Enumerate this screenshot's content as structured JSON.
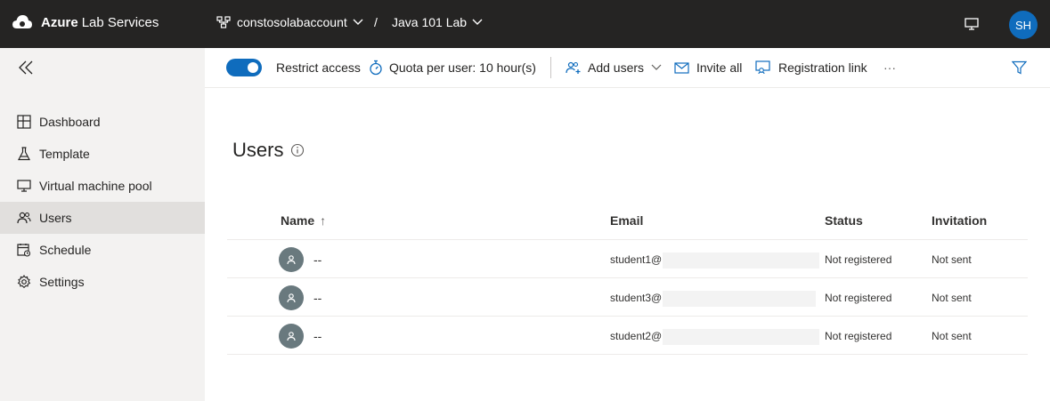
{
  "app": {
    "brand_bold": "Azure",
    "brand_rest": "Lab Services"
  },
  "breadcrumb": {
    "account": "constosolabaccount",
    "separator": "/",
    "lab": "Java 101 Lab"
  },
  "user": {
    "initials": "SH"
  },
  "sidebar": {
    "items": [
      {
        "label": "Dashboard",
        "icon": "dashboard-icon"
      },
      {
        "label": "Template",
        "icon": "flask-icon"
      },
      {
        "label": "Virtual machine pool",
        "icon": "monitor-icon"
      },
      {
        "label": "Users",
        "icon": "users-icon",
        "active": true
      },
      {
        "label": "Schedule",
        "icon": "calendar-icon"
      },
      {
        "label": "Settings",
        "icon": "gear-icon"
      }
    ]
  },
  "commandbar": {
    "restrict_access": "Restrict access",
    "restrict_access_on": true,
    "quota": "Quota per user: 10 hour(s)",
    "add_users": "Add users",
    "invite_all": "Invite all",
    "registration_link": "Registration link",
    "more": "···"
  },
  "page": {
    "title": "Users"
  },
  "table": {
    "headers": {
      "name": "Name",
      "sort": "↑",
      "email": "Email",
      "status": "Status",
      "invitation": "Invitation"
    },
    "rows": [
      {
        "name": "--",
        "email": "student1@",
        "status": "Not registered",
        "invitation": "Not sent"
      },
      {
        "name": "--",
        "email": "student3@",
        "status": "Not registered",
        "invitation": "Not sent"
      },
      {
        "name": "--",
        "email": "student2@",
        "status": "Not registered",
        "invitation": "Not sent"
      }
    ]
  },
  "colors": {
    "accent": "#0f6cbd",
    "topbar": "#252423",
    "sidebar": "#f3f2f1",
    "active_item": "#e1dfdd",
    "avatar_gray": "#69797e"
  }
}
